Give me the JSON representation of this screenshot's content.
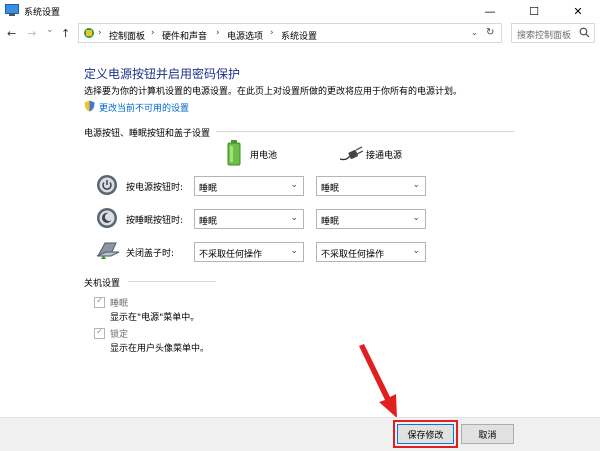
{
  "window": {
    "title": "系统设置",
    "controls": {
      "minimize": "—",
      "maximize": "☐",
      "close": "✕"
    }
  },
  "nav": {
    "back": "←",
    "forward": "→",
    "dropdown": "⌄",
    "up": "↑",
    "breadcrumb": [
      "控制面板",
      "硬件和声音",
      "电源选项",
      "系统设置"
    ],
    "separator": "›",
    "search_placeholder": "搜索控制面板"
  },
  "main": {
    "title": "定义电源按钮并启用密码保护",
    "description": "选择要为你的计算机设置的电源设置。在此页上对设置所做的更改将应用于你所有的电源计划。",
    "link": "更改当前不可用的设置"
  },
  "power_section": {
    "title": "电源按钮、睡眠按钮和盖子设置",
    "columns": {
      "battery": "用电池",
      "plugged": "接通电源"
    },
    "rows": [
      {
        "label": "按电源按钮时:",
        "battery": "睡眠",
        "plugged": "睡眠"
      },
      {
        "label": "按睡眠按钮时:",
        "battery": "睡眠",
        "plugged": "睡眠"
      },
      {
        "label": "关闭盖子时:",
        "battery": "不采取任何操作",
        "plugged": "不采取任何操作"
      }
    ]
  },
  "shutdown_section": {
    "title": "关机设置",
    "items": [
      {
        "label": "睡眠",
        "desc": "显示在\"电源\"菜单中。",
        "checked": true
      },
      {
        "label": "锁定",
        "desc": "显示在用户头像菜单中。",
        "checked": true
      }
    ]
  },
  "footer": {
    "save": "保存修改",
    "cancel": "取消"
  },
  "colors": {
    "title_blue": "#1e3287",
    "link_blue": "#0066cc",
    "highlight_red": "#e02020"
  }
}
